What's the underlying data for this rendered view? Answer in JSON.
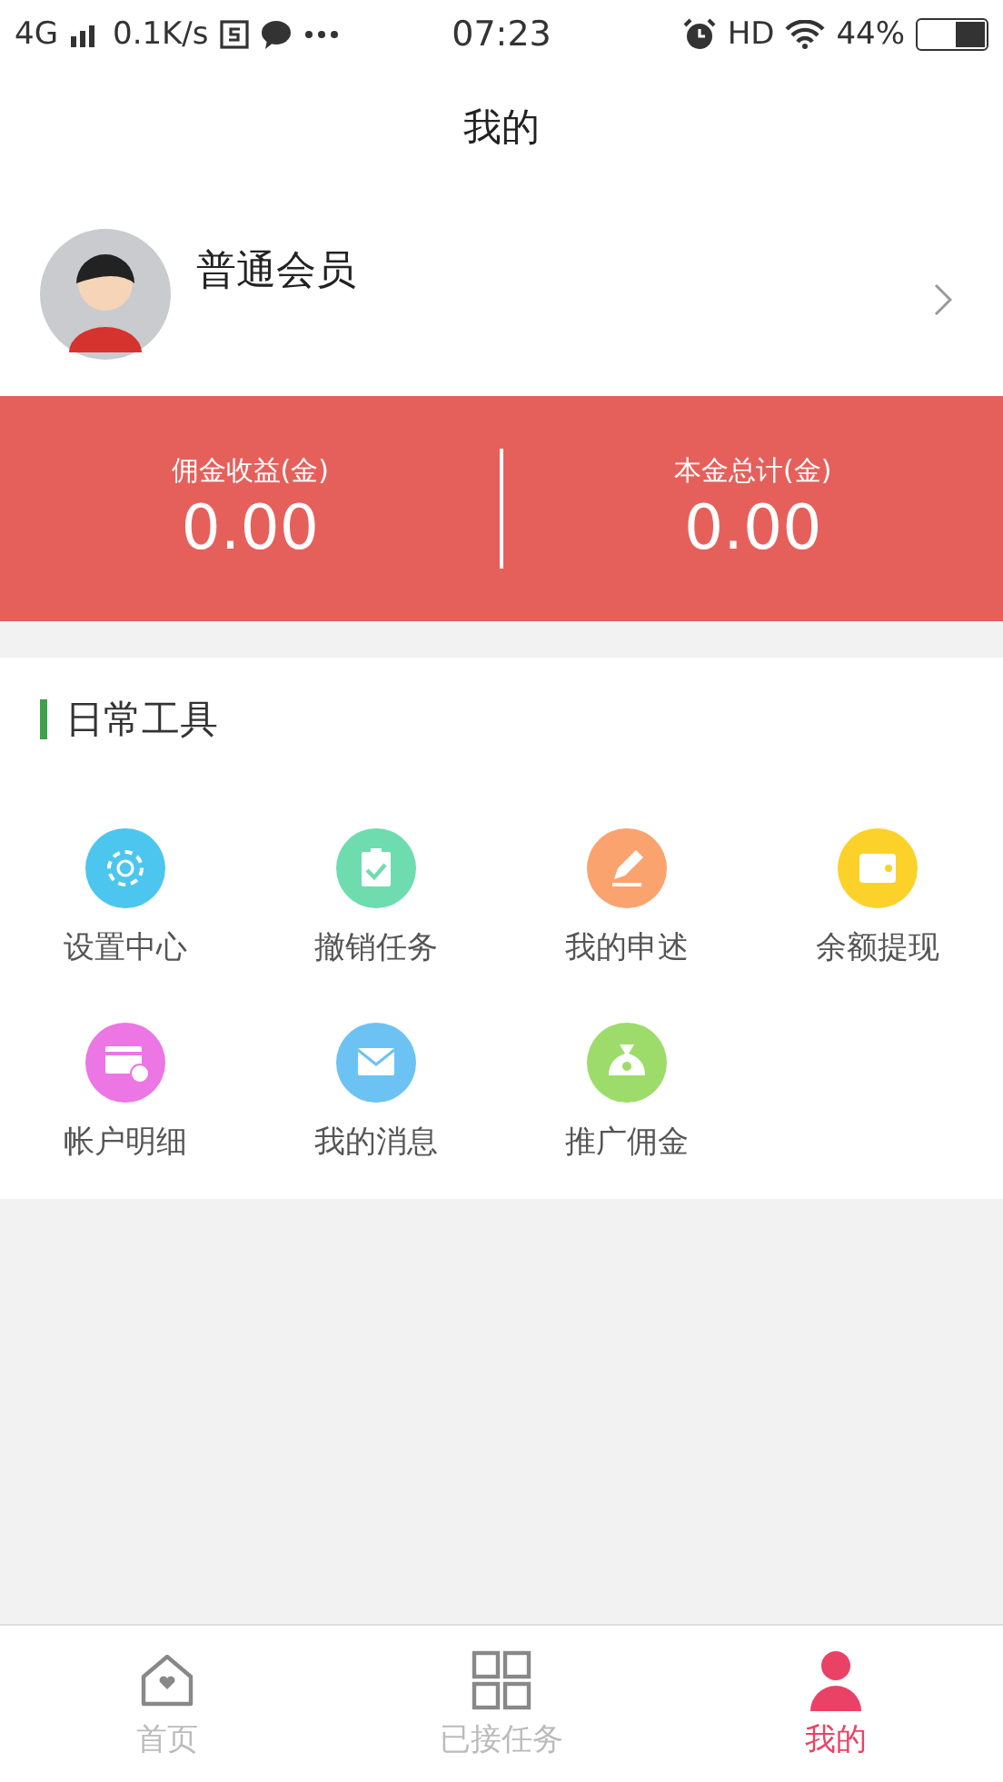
{
  "status_bar": {
    "network": "4G",
    "speed": "0.1K/s",
    "time": "07:23",
    "hd": "HD",
    "battery": "44%"
  },
  "header": {
    "title": "我的"
  },
  "profile": {
    "name": "普通会员"
  },
  "stats": [
    {
      "label": "佣金收益(金)",
      "value": "0.00"
    },
    {
      "label": "本金总计(金)",
      "value": "0.00"
    }
  ],
  "tools": {
    "title": "日常工具",
    "items": [
      {
        "label": "设置中心",
        "kind": "gear",
        "color": "#4cc6ee"
      },
      {
        "label": "撤销任务",
        "kind": "clipboard",
        "color": "#6fdcb0"
      },
      {
        "label": "我的申述",
        "kind": "pencil",
        "color": "#fba36e"
      },
      {
        "label": "余额提现",
        "kind": "wallet",
        "color": "#fcd22a"
      },
      {
        "label": "帐户明细",
        "kind": "card",
        "color": "#ec76e4"
      },
      {
        "label": "我的消息",
        "kind": "mail",
        "color": "#6cc3f3"
      },
      {
        "label": "推广佣金",
        "kind": "bag",
        "color": "#9ddc6a"
      }
    ]
  },
  "tab_bar": [
    {
      "label": "首页",
      "kind": "home",
      "selected": false
    },
    {
      "label": "已接任务",
      "kind": "grid",
      "selected": false
    },
    {
      "label": "我的",
      "kind": "person",
      "selected": true
    }
  ]
}
